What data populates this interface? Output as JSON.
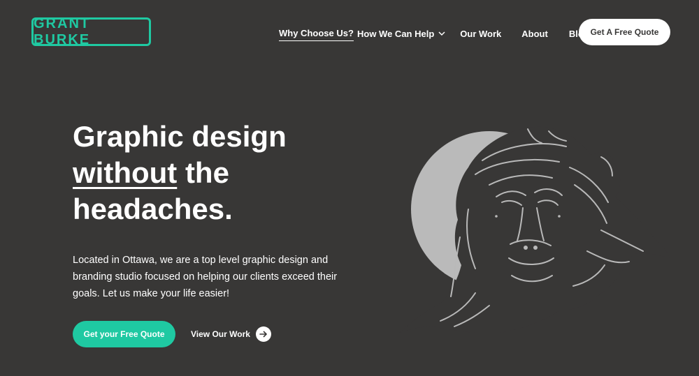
{
  "logo": {
    "text": "GRANT BURKE"
  },
  "nav": {
    "items": [
      {
        "label": "Why Choose Us?"
      },
      {
        "label": "How We Can Help"
      },
      {
        "label": "Our Work"
      },
      {
        "label": "About"
      },
      {
        "label": "Blog"
      }
    ],
    "quote_button": "Get A Free Quote"
  },
  "hero": {
    "headline_line1": "Graphic design",
    "headline_emphasis": "without",
    "headline_line2_rest": " the",
    "headline_line3": "headaches.",
    "intro": "Located in Ottawa, we are a top level graphic design and branding studio focused on helping our clients exceed their goals. Let us make your life easier!",
    "cta_primary": "Get your Free Quote",
    "cta_secondary": "View Our Work"
  },
  "illustration": {
    "subject": "chimpanzee-illustration"
  },
  "colors": {
    "background": "#383736",
    "accent": "#1fc9a2",
    "text": "#ffffff",
    "illustration": "#b9b9b9"
  }
}
